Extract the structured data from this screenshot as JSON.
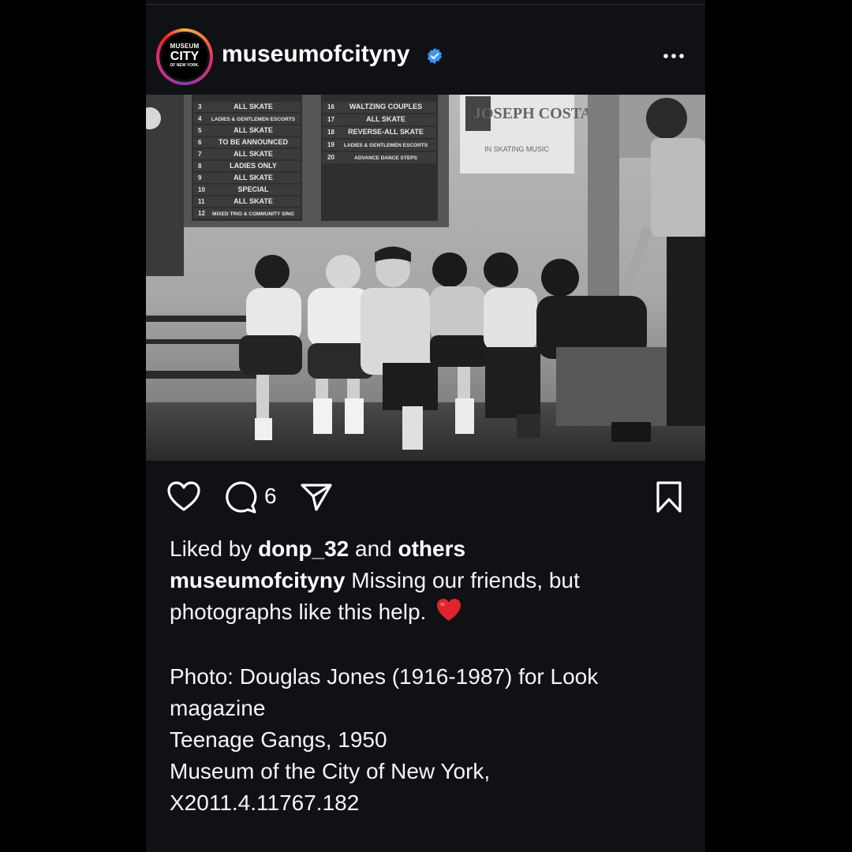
{
  "post": {
    "username": "museumofcityny",
    "avatar_text": {
      "line1": "MUSEUM",
      "line2": "CITY",
      "line3": "OF NEW YORK."
    },
    "photo_signs": {
      "schedule_left": [
        "ALL SKATE",
        "LADIES & GENTLEMEN ESCORTS",
        "ALL SKATE",
        "TO BE ANNOUNCED",
        "ALL SKATE",
        "LADIES ONLY",
        "ALL SKATE",
        "SPECIAL",
        "ALL SKATE",
        "MIXED TRIO & COMMUNITY SING"
      ],
      "schedule_left_nums": [
        "3",
        "4",
        "5",
        "6",
        "7",
        "8",
        "9",
        "10",
        "11",
        "12"
      ],
      "schedule_right": [
        "WALTZING COUPLES",
        "ALL SKATE",
        "REVERSE-ALL SKATE",
        "LADIES & GENTLEMEN ESCORTS",
        "ADVANCE DANCE STEPS"
      ],
      "schedule_right_nums": [
        "16",
        "17",
        "18",
        "19",
        "20"
      ],
      "poster_title": "JOSEPH COSTA",
      "poster_sub": "IN SKATING MUSIC"
    },
    "comment_count": "6",
    "liked_prefix": "Liked by",
    "liked_user": "donp_32",
    "liked_and": "and",
    "liked_others": "others",
    "caption_user": "museumofcityny",
    "caption_text_1": "Missing our friends, but",
    "caption_text_2": "photographs like this help.",
    "credit_line_1": "Photo: Douglas Jones (1916-1987) for Look",
    "credit_line_2": "magazine",
    "credit_line_3": "Teenage Gangs, 1950",
    "credit_line_4": "Museum of the City of New York,",
    "credit_line_5": "X2011.4.11767.182"
  },
  "icons": [
    "verified-badge-icon",
    "more-options-icon",
    "like-heart-icon",
    "comment-icon",
    "share-icon",
    "bookmark-icon",
    "red-heart-emoji-icon"
  ],
  "colors": {
    "background": "#0f1115",
    "verified": "#3897f0",
    "heart_emoji": "#e0242e"
  }
}
